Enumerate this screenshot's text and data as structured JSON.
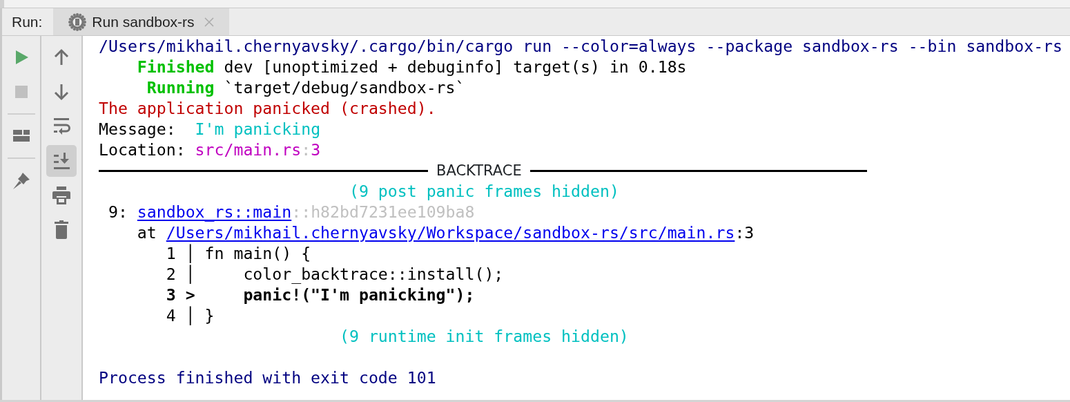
{
  "panel_label": "Run:",
  "tabs": [
    {
      "label": "Run sandbox-rs",
      "selected": true
    }
  ],
  "left_toolbar": [
    {
      "kind": "run"
    },
    {
      "kind": "stop",
      "disabled": true
    },
    {
      "kind": "separator"
    },
    {
      "kind": "layout"
    },
    {
      "kind": "separator"
    },
    {
      "kind": "pin"
    }
  ],
  "right_toolbar": [
    {
      "kind": "up",
      "selected": false
    },
    {
      "kind": "down",
      "selected": false
    },
    {
      "kind": "wrap",
      "selected": false
    },
    {
      "kind": "scroll-end",
      "selected": true
    },
    {
      "kind": "print",
      "selected": false
    },
    {
      "kind": "trash",
      "selected": false
    }
  ],
  "console": [
    {
      "kind": "text",
      "segments": [
        {
          "kind": "system",
          "text": "/Users/mikhail.chernyavsky/.cargo/bin/cargo run --color=always --package sandbox-rs --bin sandbox-rs"
        }
      ]
    },
    {
      "kind": "text",
      "segments": [
        {
          "kind": "status",
          "text": "    Finished"
        },
        {
          "kind": "plain",
          "text": " dev [unoptimized + debuginfo] target(s) in 0.18s"
        }
      ]
    },
    {
      "kind": "text",
      "segments": [
        {
          "kind": "status",
          "text": "     Running"
        },
        {
          "kind": "plain",
          "text": " `target/debug/sandbox-rs`"
        }
      ]
    },
    {
      "kind": "text",
      "segments": [
        {
          "kind": "error",
          "text": "The application panicked (crashed)."
        }
      ]
    },
    {
      "kind": "text",
      "segments": [
        {
          "kind": "plain",
          "text": "Message:  "
        },
        {
          "kind": "message",
          "text": "I'm panicking"
        }
      ]
    },
    {
      "kind": "text",
      "segments": [
        {
          "kind": "plain",
          "text": "Location: "
        },
        {
          "kind": "location",
          "text": "src/main.rs"
        },
        {
          "kind": "dim",
          "text": ":"
        },
        {
          "kind": "location",
          "text": "3"
        }
      ]
    },
    {
      "kind": "rule",
      "title": "BACKTRACE"
    },
    {
      "kind": "text",
      "segments": [
        {
          "kind": "message",
          "text": "                          (9 post panic frames hidden)"
        }
      ]
    },
    {
      "kind": "text",
      "segments": [
        {
          "kind": "plain",
          "text": " 9: "
        },
        {
          "kind": "link",
          "text": "sandbox_rs::main"
        },
        {
          "kind": "dim",
          "text": "::h82bd7231ee109ba8"
        }
      ]
    },
    {
      "kind": "text",
      "segments": [
        {
          "kind": "plain",
          "text": "    at "
        },
        {
          "kind": "link",
          "text": "/Users/mikhail.chernyavsky/Workspace/sandbox-rs/src/main.rs"
        },
        {
          "kind": "plain",
          "text": ":3"
        }
      ]
    },
    {
      "kind": "text",
      "segments": [
        {
          "kind": "plain",
          "text": "       1 │ fn main() {"
        }
      ]
    },
    {
      "kind": "text",
      "segments": [
        {
          "kind": "plain",
          "text": "       2 │     color_backtrace::install();"
        }
      ]
    },
    {
      "kind": "text",
      "segments": [
        {
          "kind": "current",
          "text": "       3 >     panic!(\"I'm panicking\");"
        }
      ]
    },
    {
      "kind": "text",
      "segments": [
        {
          "kind": "plain",
          "text": "       4 │ }"
        }
      ]
    },
    {
      "kind": "text",
      "segments": [
        {
          "kind": "message",
          "text": "                         (9 runtime init frames hidden)"
        }
      ]
    },
    {
      "kind": "blank"
    },
    {
      "kind": "text",
      "segments": [
        {
          "kind": "system",
          "text": "Process finished with exit code 101"
        }
      ]
    }
  ]
}
